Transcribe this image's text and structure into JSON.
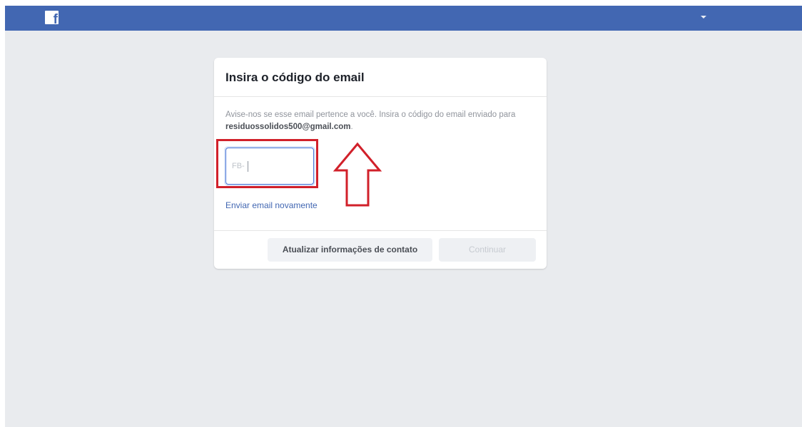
{
  "header": {
    "logo_glyph": "f",
    "logo_icon": "facebook-logo-icon",
    "menu_icon": "caret-down-icon",
    "brand_color": "#4267b2"
  },
  "dialog": {
    "title": "Insira o código do email",
    "description_prefix": "Avise-nos se esse email pertence a você. Insira o código do email enviado para ",
    "email": "residuossolidos500@gmail.com",
    "description_suffix": ".",
    "code_input": {
      "prefix": "FB-",
      "value": ""
    },
    "resend_link": "Enviar email novamente",
    "buttons": {
      "update_contact": "Atualizar informações de contato",
      "continue": "Continuar"
    }
  },
  "annotation": {
    "highlight_color": "#d1202a",
    "arrow_icon": "up-arrow-outline-icon"
  }
}
